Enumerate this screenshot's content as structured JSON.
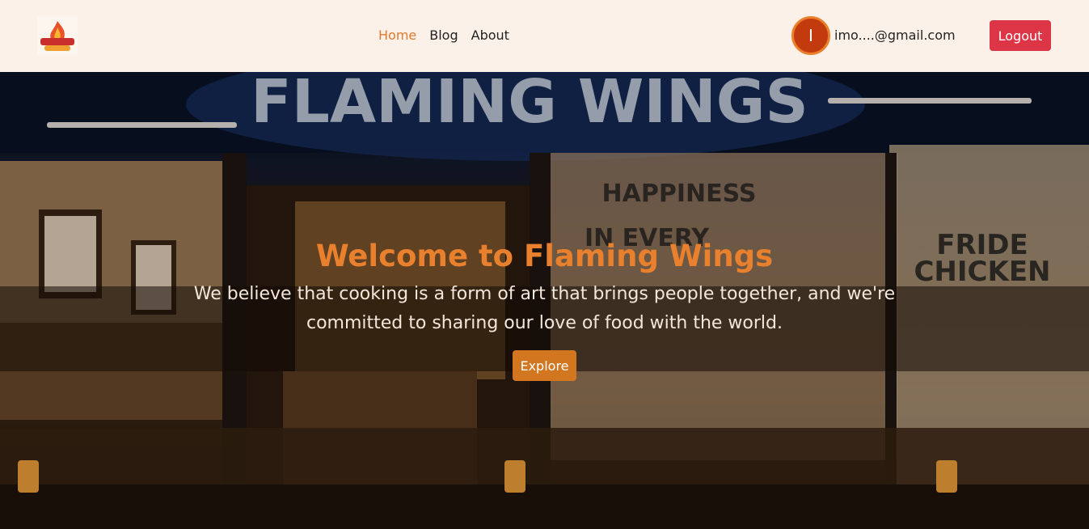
{
  "nav": {
    "logo_text": "FLAMING WINGS",
    "links": [
      {
        "label": "Home",
        "active": true
      },
      {
        "label": "Blog",
        "active": false
      },
      {
        "label": "About",
        "active": false
      }
    ],
    "user_initial": "I",
    "user_email": "imo....@gmail.com",
    "logout_label": "Logout"
  },
  "hero": {
    "sign_text": "FLAMING WINGS",
    "title": "Welcome to Flaming Wings",
    "text": "We believe that cooking is a form of art that brings people together, and we're committed to sharing our love of food with the world.",
    "explore_label": "Explore"
  },
  "colors": {
    "accent": "#e8802d",
    "nav_bg": "#fcf1e9",
    "logout": "#dc3545",
    "explore": "#d2761f"
  }
}
